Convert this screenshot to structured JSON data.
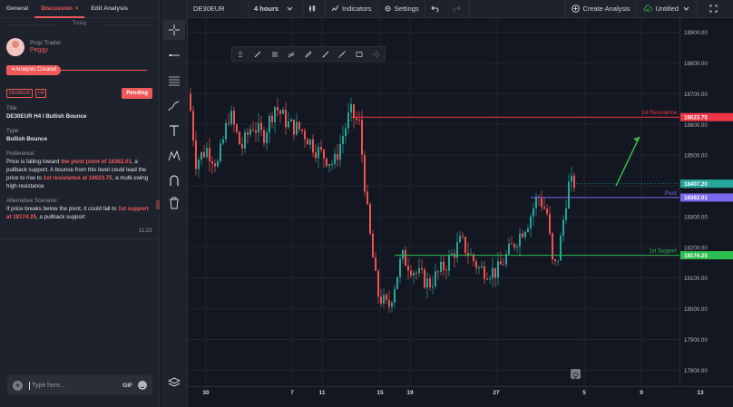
{
  "left_panel": {
    "tabs": [
      {
        "label": "General"
      },
      {
        "label": "Discussion",
        "close": "×"
      },
      {
        "label": "Edit Analysis"
      }
    ],
    "day_separator": "Today",
    "post": {
      "author_role": "Prop Trader",
      "author_name": "Peggy",
      "status_flag": "Analysis Created",
      "tags": [
        "DE30EUR",
        "H4"
      ],
      "status_badge": "Pending",
      "title_label": "Title",
      "title": "DE30EUR H4 I Bullish Bounce",
      "type_label": "Type",
      "type": "Bullish Bounce",
      "preference_label": "Preference:",
      "preference": {
        "p1": "Price is falling toward ",
        "h1": "the pivot point of 18362.01",
        "p2": ", a pullback support. A bounce from this level could lead the price to rise to ",
        "h2": "1st resistance at 18623.75",
        "p3": ", a multi-swing high resistance"
      },
      "alt_label": "Alternative Scenario:",
      "alternative": {
        "p1": "If price breaks below the pivot, it could fall to ",
        "h1": "1st support at 18174.25",
        "p2": ", a pullback support"
      },
      "time": "11:22"
    },
    "composer": {
      "placeholder": "Type here...",
      "gif_label": "GIF"
    }
  },
  "topbar": {
    "symbol": "DE30EUR",
    "interval": "4 hours",
    "indicators_label": "Indicators",
    "settings_label": "Settings",
    "create_analysis_label": "Create Analysis",
    "layout_name": "Untitled"
  },
  "drawing_tools": [
    "drag-handle-icon",
    "trend-line-icon",
    "fib-icon",
    "parallel-channel-icon",
    "pencil-icon",
    "ray-icon",
    "extended-line-icon",
    "rectangle-icon",
    "crosshair-icon"
  ],
  "left_toolbar": [
    "crosshair-icon",
    "horizontal-line-icon",
    "fib-retracement-icon",
    "brush-icon",
    "text-icon",
    "pattern-icon",
    "magnet-icon",
    "trash-icon",
    "layers-icon"
  ],
  "colors": {
    "accent": "#f05a5a",
    "up": "#26a69a",
    "down": "#ef5350",
    "resistance": "#f23645",
    "pivot": "#7b68ee",
    "support": "#2ebd4f",
    "projection": "#3bb44a"
  },
  "chart_data": {
    "type": "candlestick",
    "symbol": "DE30EUR",
    "interval": "4 hours",
    "y_ticks": [
      18900,
      18800,
      18700,
      18600,
      18500,
      18400,
      18300,
      18200,
      18100,
      18000,
      17900,
      17800
    ],
    "y_tick_labels": [
      "18900.00",
      "18800.00",
      "18700.00",
      "18600.00",
      "18500.00",
      "18400.00",
      "18300.00",
      "18200.00",
      "18100.00",
      "18000.00",
      "17900.00",
      "17800.00"
    ],
    "ylim": [
      17760,
      18940
    ],
    "x_tick_labels": [
      "30",
      "7",
      "11",
      "15",
      "19",
      "27",
      "5",
      "9",
      "13"
    ],
    "levels": [
      {
        "name": "1st Resistance",
        "value": 18623.75,
        "label": "18623.75"
      },
      {
        "name": "Pivot",
        "value": 18362.01,
        "label": "18362.01"
      },
      {
        "name": "1st Support",
        "value": 18174.25,
        "label": "18174.25"
      }
    ],
    "last_price": {
      "value": 18407.2,
      "label": "18407.20"
    },
    "projection_arrow": {
      "from": 18400,
      "to": 18560
    }
  }
}
